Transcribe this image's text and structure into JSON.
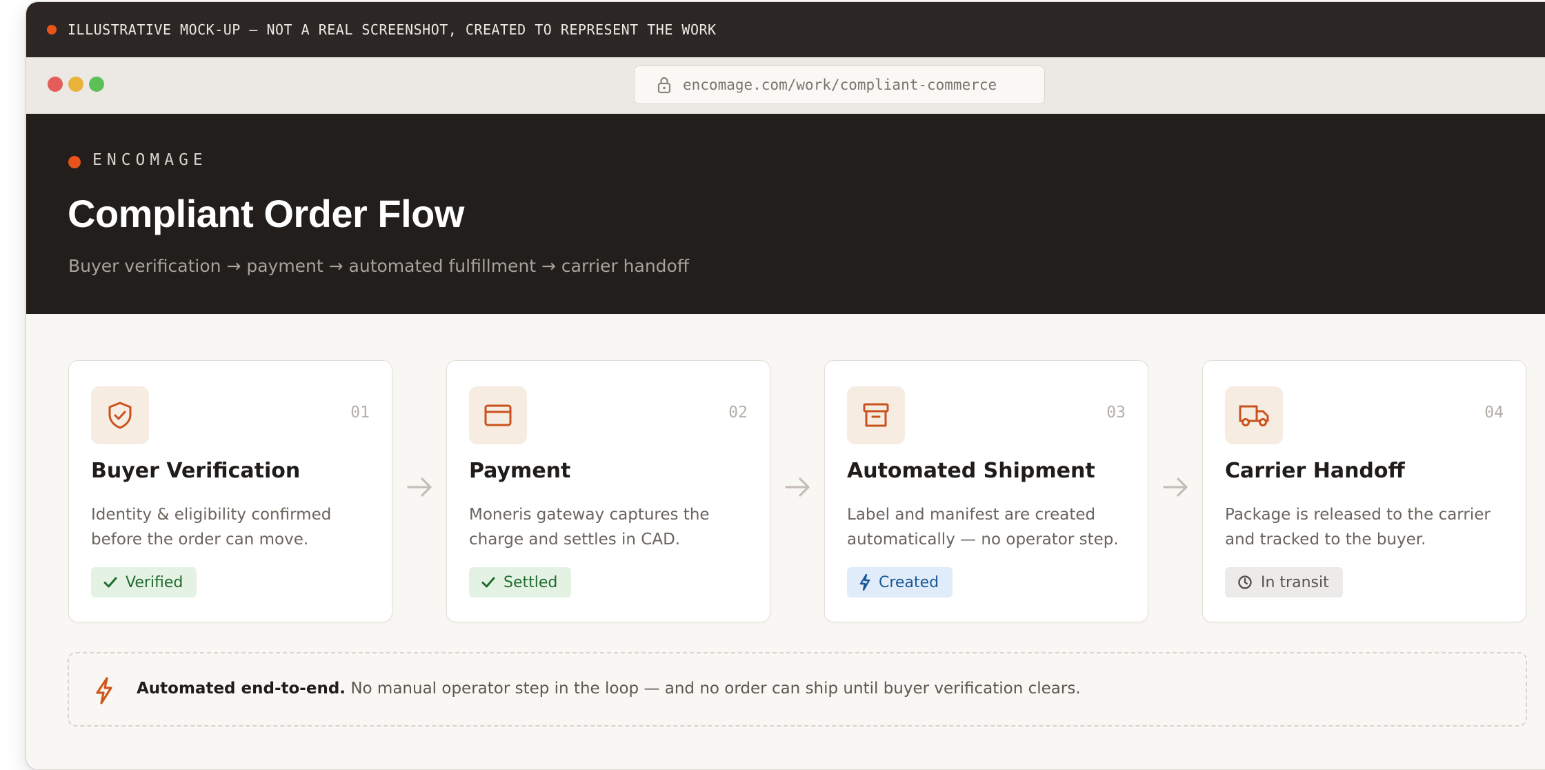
{
  "banner": {
    "text": "ILLUSTRATIVE MOCK-UP — NOT A REAL SCREENSHOT, CREATED TO REPRESENT THE WORK"
  },
  "browser": {
    "url": "encomage.com/work/compliant-commerce",
    "lock_icon": "lock-icon"
  },
  "hero": {
    "brand": "ENCOMAGE",
    "title": "Compliant Order Flow",
    "subtitle": "Buyer verification → payment → automated fulfillment → carrier handoff"
  },
  "steps": [
    {
      "number": "01",
      "icon": "shield-check-icon",
      "title": "Buyer Verification",
      "desc_line1": "Identity & eligibility confirmed",
      "desc_line2": "before the order can move.",
      "badge": "Verified",
      "badge_icon": "check-icon",
      "badge_color": "#1f6b2e"
    },
    {
      "number": "02",
      "icon": "credit-card-icon",
      "title": "Payment",
      "desc_line1": "Moneris gateway captures the",
      "desc_line2": "charge and settles in CAD.",
      "badge": "Settled",
      "badge_icon": "check-icon",
      "badge_color": "#1f6b2e"
    },
    {
      "number": "03",
      "icon": "archive-box-icon",
      "title": "Automated Shipment",
      "desc_line1": "Label and manifest are created",
      "desc_line2": "automatically — no operator step.",
      "badge": "Created",
      "badge_icon": "lightning-icon",
      "badge_color": "#1b5796"
    },
    {
      "number": "04",
      "icon": "truck-icon",
      "title": "Carrier Handoff",
      "desc_line1": "Package is released to the carrier",
      "desc_line2": "and tracked to the buyer.",
      "badge": "In transit",
      "badge_icon": "clock-icon",
      "badge_color": "#56524d"
    }
  ],
  "note": {
    "strong": "Automated end-to-end.",
    "text": " No manual operator step in the loop — and no order can ship until buyer verification clears.",
    "icon": "lightning-icon"
  },
  "colors": {
    "accent": "#e8531a",
    "icon_orange": "#c9521c",
    "hero_bg": "#211e1c",
    "banner_bg": "#2c2724"
  }
}
